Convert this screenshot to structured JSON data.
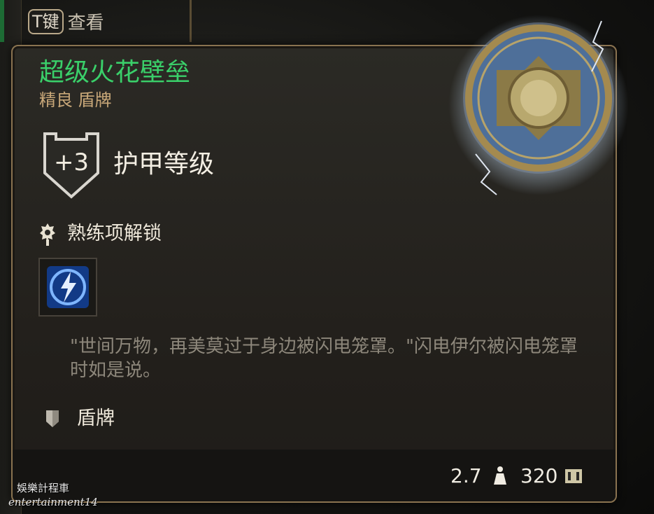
{
  "hint": {
    "key": "T键",
    "text": "查看"
  },
  "item": {
    "name": "超级火花壁垒",
    "subtitle": "精良 盾牌",
    "name_color": "#3ad06a",
    "subtitle_color": "#c9a879"
  },
  "armor": {
    "value": "+3",
    "label": "护甲等级"
  },
  "proficiency": {
    "label": "熟练项解锁",
    "ability_icon": "lightning-shield-icon"
  },
  "flavor_text": "\"世间万物，再美莫过于身边被闪电笼罩。\"闪电伊尔被闪电笼罩时如是说。",
  "item_type": {
    "label": "盾牌"
  },
  "footer": {
    "weight": "2.7",
    "value": "320"
  },
  "watermark": {
    "line1": "娛樂計程車",
    "line2": "entertainment14"
  }
}
